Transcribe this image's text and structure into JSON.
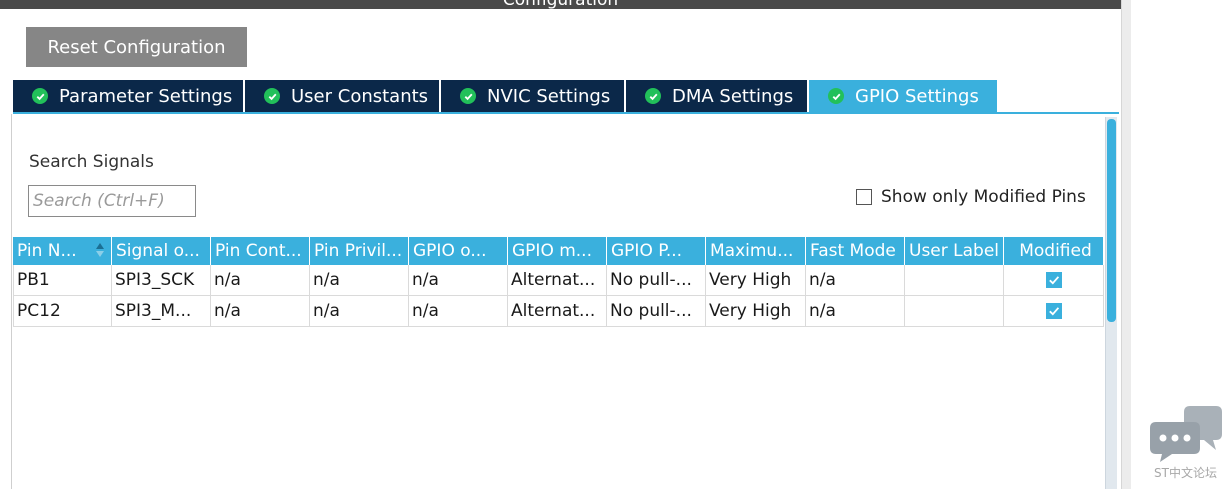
{
  "window": {
    "title": "Configuration"
  },
  "toolbar": {
    "reset_label": "Reset Configuration"
  },
  "tabs": [
    {
      "label": "Parameter Settings",
      "active": false
    },
    {
      "label": "User Constants",
      "active": false
    },
    {
      "label": "NVIC Settings",
      "active": false
    },
    {
      "label": "DMA Settings",
      "active": false
    },
    {
      "label": "GPIO Settings",
      "active": true
    }
  ],
  "search": {
    "label": "Search Signals",
    "placeholder": "Search (Ctrl+F)",
    "value": ""
  },
  "filter": {
    "modified_only_label": "Show only Modified Pins",
    "checked": false
  },
  "table": {
    "columns": [
      "Pin N...",
      "Signal o...",
      "Pin Cont...",
      "Pin Privil...",
      "GPIO o...",
      "GPIO m...",
      "GPIO P...",
      "Maximu...",
      "Fast Mode",
      "User Label",
      "Modified"
    ],
    "rows": [
      [
        "PB1",
        "SPI3_SCK",
        "n/a",
        "n/a",
        "n/a",
        "Alternat...",
        "No pull-...",
        "Very High",
        "n/a",
        "",
        ""
      ],
      [
        "PC12",
        "SPI3_M...",
        "n/a",
        "n/a",
        "n/a",
        "Alternat...",
        "No pull-...",
        "Very High",
        "n/a",
        "",
        ""
      ]
    ],
    "modified": [
      true,
      true
    ]
  },
  "watermark": {
    "text": "ST中文论坛",
    "icon": "chat-bubbles-icon"
  },
  "colors": {
    "accent": "#3ab0dd",
    "tab_dark": "#0b2849",
    "check_green": "#22c05a",
    "button_gray": "#868686"
  }
}
